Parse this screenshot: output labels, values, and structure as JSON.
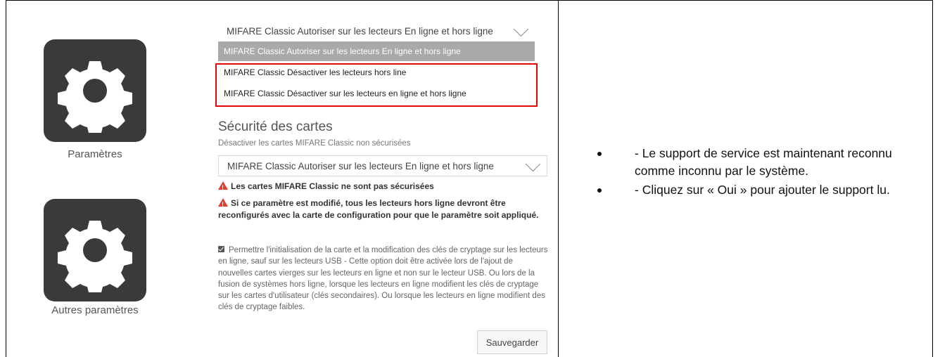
{
  "left_column": {
    "settings_label": "Paramètres",
    "other_settings_label": "Autres paramètres",
    "settings_icon": "gear-icon",
    "other_settings_icon": "gear-icon"
  },
  "dropdown": {
    "selected_value": "MIFARE Classic Autoriser sur les lecteurs En ligne et hors ligne",
    "options": [
      "MIFARE Classic Autoriser sur les lecteurs En ligne et hors ligne",
      "MIFARE Classic Désactiver les lecteurs hors line",
      "MIFARE Classic Désactiver sur les lecteurs en ligne et hors ligne"
    ]
  },
  "card_security": {
    "title": "Sécurité des cartes",
    "subtitle": "Désactiver les cartes MIFARE Classic non sécurisées",
    "select_value": "MIFARE Classic Autoriser sur les lecteurs En ligne et hors ligne",
    "warning_1": "Les cartes MIFARE Classic ne sont pas sécurisées",
    "warning_2": "Si ce paramètre est modifié, tous les lecteurs hors ligne devront être reconfigurés avec la carte de configuration pour que le paramètre soit appliqué.",
    "checkbox_checked": true,
    "checkbox_text": "Permettre l'initialisation de la carte et la modification des clés de cryptage sur les lecteurs en ligne, sauf sur les lecteurs USB - Cette option doit être activée lors de l'ajout de nouvelles cartes vierges sur les lecteurs en ligne et non sur le lecteur USB. Ou lors de la fusion de systèmes hors ligne, lorsque les lecteurs en ligne modifient les clés de cryptage sur les cartes d'utilisateur (clés secondaires). Ou lorsque les lecteurs en ligne modifient des clés de cryptage faibles.",
    "save_label": "Sauvegarder"
  },
  "instructions": [
    "- Le support de service est maintenant reconnu comme inconnu par le système.",
    "- Cliquez sur « Oui » pour ajouter le support lu."
  ],
  "colors": {
    "highlight_box": "#e10600",
    "tile": "#3a3a3a",
    "warning": "#e03b2d"
  }
}
